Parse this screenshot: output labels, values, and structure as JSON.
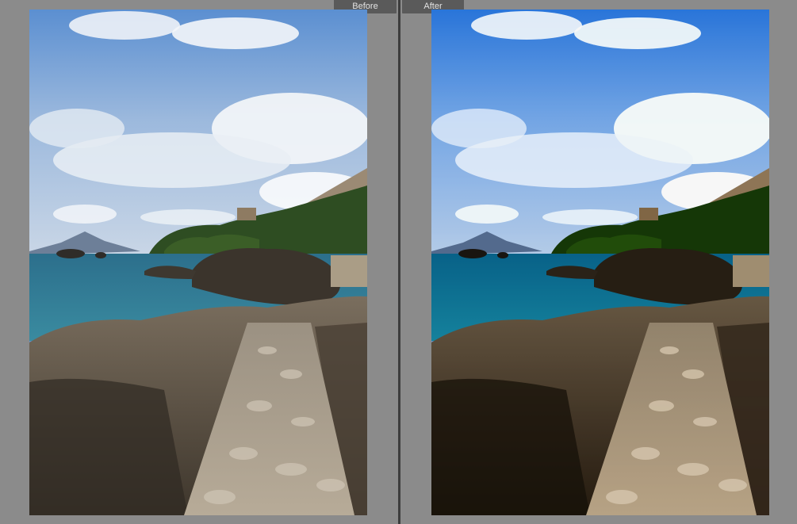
{
  "compare_view": {
    "before_label": "Before",
    "after_label": "After"
  },
  "photo": {
    "subject": "rocky-coastline-stone-path"
  },
  "colors": {
    "workspace_background": "#8b8b8b",
    "divider": "#3d3d3d",
    "label_tab": "#5a5a5a",
    "label_text": "#e2e2e2"
  }
}
